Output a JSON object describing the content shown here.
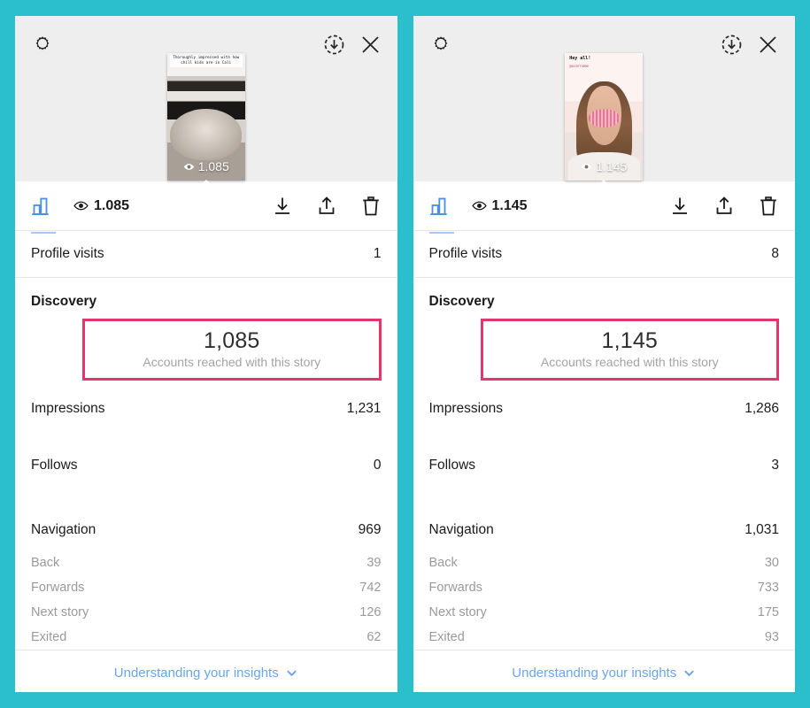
{
  "theme": {
    "background": "#2BBECC",
    "panel": "#FFFFFF",
    "highlight_pink": "#E8336D",
    "link_blue": "#6BA4E8",
    "chart_icon_blue": "#4A90E2",
    "muted_text": "#9A9A9A"
  },
  "stories": [
    {
      "id": "story-left",
      "thumbnail": {
        "caption": "Thoroughly impressed with how chill kids are in Cali",
        "views_overlay": "1.085",
        "alt": "skatepark bowl photo"
      },
      "header": {
        "settings_icon": "gear-icon",
        "download_icon": "download-circle-icon",
        "close_icon": "close-icon"
      },
      "actionbar": {
        "chart_icon": "bar-chart-icon",
        "eye_icon": "eye-icon",
        "views": "1.085",
        "save_icon": "download-icon",
        "share_icon": "share-icon",
        "delete_icon": "trash-icon"
      },
      "profile_visits": {
        "label": "Profile visits",
        "value": "1"
      },
      "discovery": {
        "title": "Discovery",
        "reach_value": "1,085",
        "reach_label": "Accounts reached with this story"
      },
      "impressions": {
        "label": "Impressions",
        "value": "1,231"
      },
      "follows": {
        "label": "Follows",
        "value": "0"
      },
      "navigation": {
        "label": "Navigation",
        "value": "969",
        "items": [
          {
            "label": "Back",
            "value": "39"
          },
          {
            "label": "Forwards",
            "value": "742"
          },
          {
            "label": "Next story",
            "value": "126"
          },
          {
            "label": "Exited",
            "value": "62"
          }
        ]
      },
      "footer": {
        "label": "Understanding your insights",
        "chevron": "chevron-down-icon"
      }
    },
    {
      "id": "story-right",
      "thumbnail": {
        "caption": "Hey all!",
        "subcaption": "@username",
        "views_overlay": "1.145",
        "alt": "portrait selfie with face filter"
      },
      "header": {
        "settings_icon": "gear-icon",
        "download_icon": "download-circle-icon",
        "close_icon": "close-icon"
      },
      "actionbar": {
        "chart_icon": "bar-chart-icon",
        "eye_icon": "eye-icon",
        "views": "1.145",
        "save_icon": "download-icon",
        "share_icon": "share-icon",
        "delete_icon": "trash-icon"
      },
      "profile_visits": {
        "label": "Profile visits",
        "value": "8"
      },
      "discovery": {
        "title": "Discovery",
        "reach_value": "1,145",
        "reach_label": "Accounts reached with this story"
      },
      "impressions": {
        "label": "Impressions",
        "value": "1,286"
      },
      "follows": {
        "label": "Follows",
        "value": "3"
      },
      "navigation": {
        "label": "Navigation",
        "value": "1,031",
        "items": [
          {
            "label": "Back",
            "value": "30"
          },
          {
            "label": "Forwards",
            "value": "733"
          },
          {
            "label": "Next story",
            "value": "175"
          },
          {
            "label": "Exited",
            "value": "93"
          }
        ]
      },
      "footer": {
        "label": "Understanding your insights",
        "chevron": "chevron-down-icon"
      }
    }
  ]
}
